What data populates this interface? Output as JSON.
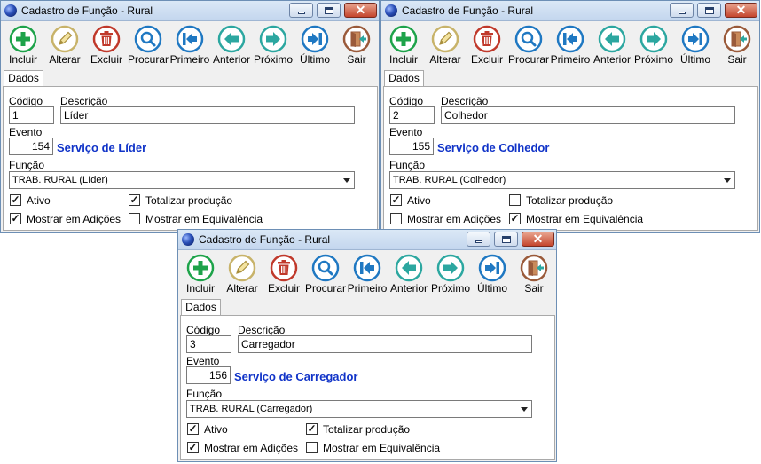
{
  "window_title": "Cadastro de Função - Rural",
  "toolbar": {
    "incluir": "Incluir",
    "alterar": "Alterar",
    "excluir": "Excluir",
    "procurar": "Procurar",
    "primeiro": "Primeiro",
    "anterior": "Anterior",
    "proximo": "Próximo",
    "ultimo": "Último",
    "sair": "Sair"
  },
  "tab_label": "Dados",
  "labels": {
    "codigo": "Código",
    "descricao": "Descrição",
    "evento": "Evento",
    "funcao": "Função",
    "ativo": "Ativo",
    "totalizar": "Totalizar produção",
    "mostrar_adicoes": "Mostrar em Adições",
    "mostrar_equivalencia": "Mostrar em Equivalência"
  },
  "colors": {
    "event_text": "#1033c8",
    "green": "#1ea34a",
    "olive": "#c8b36a",
    "red": "#c0392b",
    "blue": "#1f78c2",
    "teal": "#2ca7a0",
    "brown": "#9a5a3a"
  },
  "icons": [
    "plus-icon",
    "pencil-icon",
    "trash-icon",
    "magnifier-icon",
    "first-record-icon",
    "previous-arrow-icon",
    "next-arrow-icon",
    "last-record-icon",
    "exit-door-icon"
  ],
  "windows": [
    {
      "codigo": "1",
      "descricao": "Líder",
      "evento": "154",
      "evento_desc": "Serviço de Líder",
      "funcao": "TRAB. RURAL (Líder)",
      "ativo": true,
      "totalizar": true,
      "mostrar_adicoes": true,
      "mostrar_equivalencia": false
    },
    {
      "codigo": "2",
      "descricao": "Colhedor",
      "evento": "155",
      "evento_desc": "Serviço de Colhedor",
      "funcao": "TRAB. RURAL (Colhedor)",
      "ativo": true,
      "totalizar": false,
      "mostrar_adicoes": false,
      "mostrar_equivalencia": true
    },
    {
      "codigo": "3",
      "descricao": "Carregador",
      "evento": "156",
      "evento_desc": "Serviço de Carregador",
      "funcao": "TRAB. RURAL (Carregador)",
      "ativo": true,
      "totalizar": true,
      "mostrar_adicoes": true,
      "mostrar_equivalencia": false
    }
  ]
}
